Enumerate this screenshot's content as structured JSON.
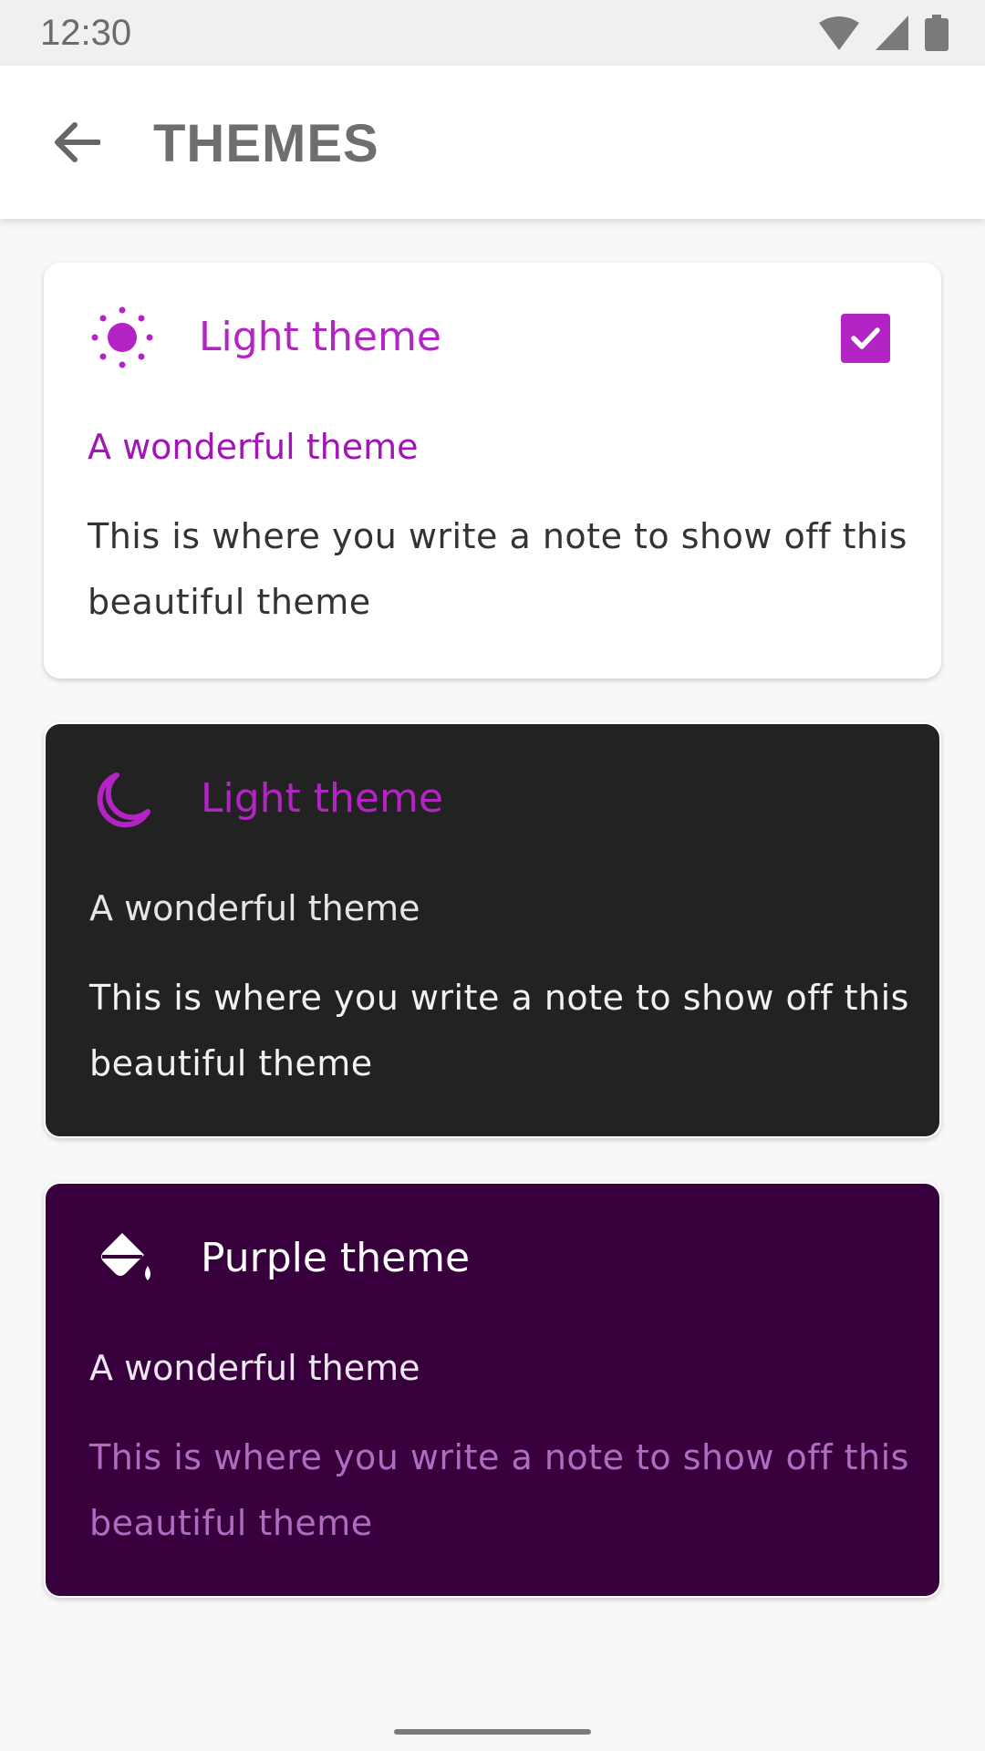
{
  "status_bar": {
    "time": "12:30",
    "icons": [
      "wifi-icon",
      "signal-icon",
      "battery-icon"
    ]
  },
  "app_bar": {
    "title": "THEMES",
    "back_icon": "arrow-left-icon"
  },
  "colors": {
    "accent": "#b324c4",
    "subtitle_light": "#9f16b2",
    "body_text_light": "#333333",
    "dark_card_bg": "#222222",
    "purple_card_bg": "#37003c",
    "purple_body_text": "#b06cc0"
  },
  "themes": [
    {
      "icon": "sun-icon",
      "title": "Light theme",
      "subtitle": "A wonderful theme",
      "body": "This is where you write a note to show off this beautiful theme",
      "selected": true
    },
    {
      "icon": "moon-icon",
      "title": "Light theme",
      "subtitle": "A wonderful theme",
      "body": "This is where you write a note to show off this beautiful theme",
      "selected": false
    },
    {
      "icon": "paint-bucket-icon",
      "title": "Purple theme",
      "subtitle": "A wonderful theme",
      "body": "This is where you write a note to show off this beautiful theme",
      "selected": false
    }
  ]
}
